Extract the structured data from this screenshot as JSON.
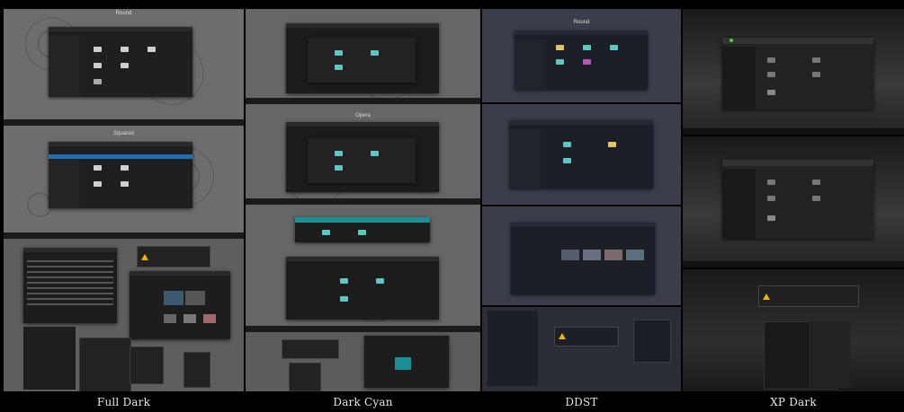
{
  "columns": [
    {
      "caption": "Full Dark",
      "panels": [
        {
          "label": "Round"
        },
        {
          "label": "Squared"
        }
      ]
    },
    {
      "caption": "Dark Cyan",
      "panels": [
        {
          "label": ""
        },
        {
          "label": "Opera"
        }
      ]
    },
    {
      "caption": "DDST",
      "panels": [
        {
          "label": "Round"
        }
      ]
    },
    {
      "caption": "XP Dark",
      "panels": []
    }
  ],
  "colors": {
    "full_dark_bg": "#6b6b6b",
    "dark_cyan_bg": "#646464",
    "ddst_bg": "#3b3e4a",
    "xp_bg": "#2a2a2a",
    "cyan_accent": "#1b8f93",
    "blue_accent": "#1e6fb3",
    "folder_yellow": "#e1c56a",
    "folder_cyan": "#5fc7c1"
  },
  "icons": [
    "folder-icon",
    "warning-icon",
    "drive-icon",
    "start-icon"
  ]
}
